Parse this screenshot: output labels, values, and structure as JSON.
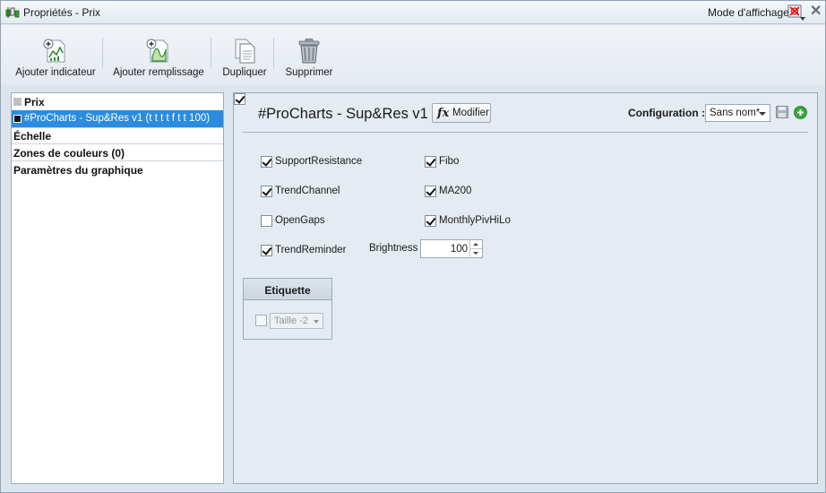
{
  "window": {
    "title": "Propriétés - Prix",
    "mode_label": "Mode d'affichage",
    "icons": [
      "chart-candles-icon",
      "display-mode-icon",
      "close-icon"
    ]
  },
  "toolbar": {
    "add_indicator": "Ajouter indicateur",
    "add_fill": "Ajouter remplissage",
    "duplicate": "Dupliquer",
    "delete": "Supprimer"
  },
  "tree": {
    "items": [
      {
        "label": "Prix",
        "swatch": "#c0c0c0"
      },
      {
        "label": "#ProCharts - Sup&Res v1 (t t t t f t t 100)",
        "swatch": "#111111",
        "selected": true
      },
      {
        "label": "Échelle"
      },
      {
        "label": "Zones de couleurs (0)"
      },
      {
        "label": "Paramètres du graphique"
      }
    ]
  },
  "panel": {
    "title": "#ProCharts - Sup&Res v1",
    "title_checked": true,
    "modify_label": "Modifier",
    "config_label": "Configuration :",
    "config_value": "Sans nom*",
    "options": [
      {
        "label": "SupportResistance",
        "checked": true
      },
      {
        "label": "TrendChannel",
        "checked": true
      },
      {
        "label": "OpenGaps",
        "checked": false
      },
      {
        "label": "TrendReminder",
        "checked": true
      },
      {
        "label": "Fibo",
        "checked": true
      },
      {
        "label": "MA200",
        "checked": true
      },
      {
        "label": "MonthlyPivHiLo",
        "checked": true
      }
    ],
    "brightness_label": "Brightness",
    "brightness_value": "100",
    "etiquette": {
      "title": "Etiquette",
      "checked": false,
      "size_value": "Taille -2"
    }
  },
  "colors": {
    "selection": "#2a8ce0",
    "add_green": "#35a83a"
  }
}
